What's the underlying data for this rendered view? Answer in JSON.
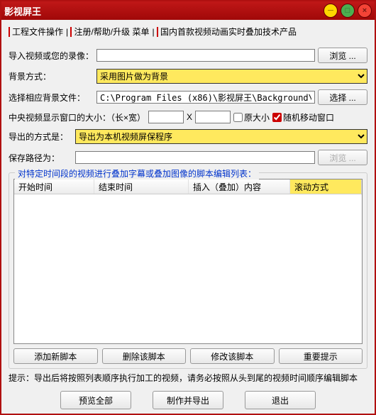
{
  "title": "影视屏王",
  "menu": {
    "m1": "工程文件操作",
    "m2": "注册/帮助/升级 菜单",
    "m3": "国内首款视频动画实时叠加技术产品"
  },
  "labels": {
    "import": "导入视频或您的录像：",
    "bgmode": "背景方式：",
    "bgfile": "选择相应背景文件：",
    "winsize": "中央视频显示窗口的大小：（长×宽）",
    "exportmode": "导出的方式是：",
    "savepath": "保存路径为：",
    "x": "X",
    "origsize": "原大小",
    "randmove": "随机移动窗口",
    "grouplegend": "对特定时间段的视频进行叠加字幕或叠加图像的脚本编辑列表：",
    "hint": "提示：导出后将按照列表顺序执行加工的视频，请务必按照从头到尾的视频时间顺序编辑脚本"
  },
  "values": {
    "bgfile": "C:\\Program Files (x86)\\影视屏王\\Background\\",
    "randmove_checked": true
  },
  "options": {
    "bgmode": "采用图片做为背景",
    "exportmode": "导出为本机视频屏保程序"
  },
  "buttons": {
    "browse": "浏览 ...",
    "select": "选择 ...",
    "browse2": "浏览 ...",
    "addscript": "添加新脚本",
    "delscript": "删除该脚本",
    "editscript": "修改该脚本",
    "important": "重要提示",
    "previewall": "预览全部",
    "makeexport": "制作并导出",
    "exit": "退出"
  },
  "columns": {
    "c1": "开始时间",
    "c2": "结束时间",
    "c3": "插入（叠加）内容",
    "c4": "滚动方式"
  }
}
